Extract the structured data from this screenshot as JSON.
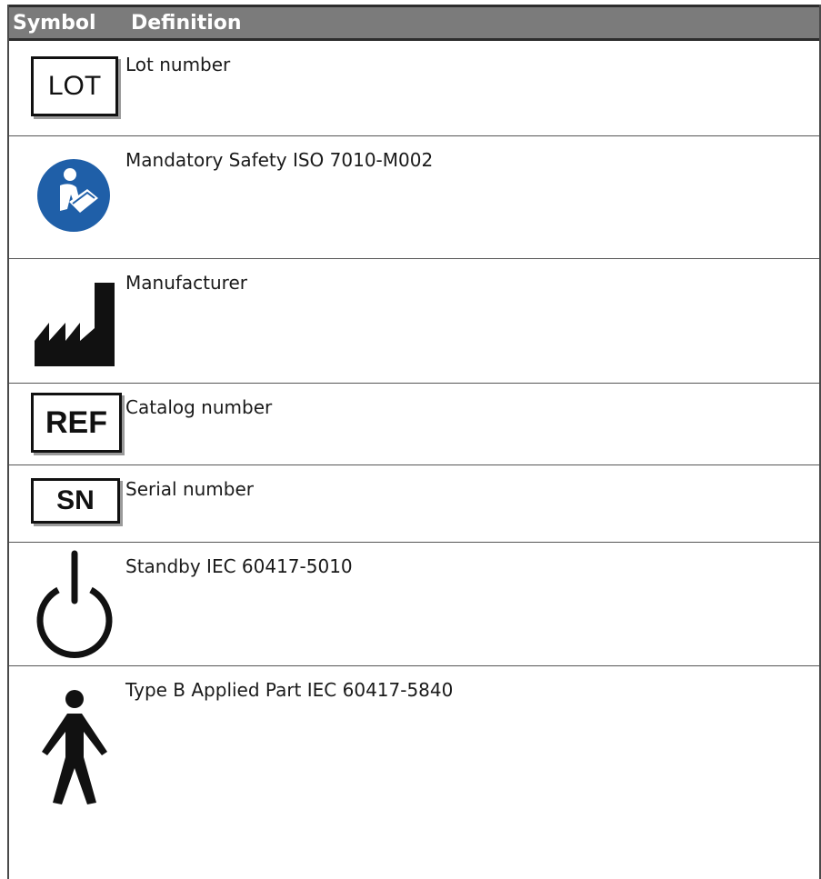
{
  "header": {
    "symbol_label": "Symbol",
    "definition_label": "Definition"
  },
  "rows": [
    {
      "icon": "lot-icon",
      "icon_text": "LOT",
      "definition": "Lot number"
    },
    {
      "icon": "read-manual-icon",
      "definition": "Mandatory Safety ISO 7010-M002"
    },
    {
      "icon": "manufacturer-icon",
      "definition": "Manufacturer"
    },
    {
      "icon": "ref-icon",
      "icon_text": "REF",
      "definition": "Catalog number"
    },
    {
      "icon": "sn-icon",
      "icon_text": "SN",
      "definition": "Serial number"
    },
    {
      "icon": "standby-icon",
      "definition": "Standby IEC 60417-5010"
    },
    {
      "icon": "type-b-applied-part-icon",
      "definition": "Type B Applied Part IEC 60417-5840"
    }
  ],
  "colors": {
    "header_bg": "#7b7b7b",
    "header_text": "#ffffff",
    "manual_icon_blue": "#1f5fa8"
  }
}
